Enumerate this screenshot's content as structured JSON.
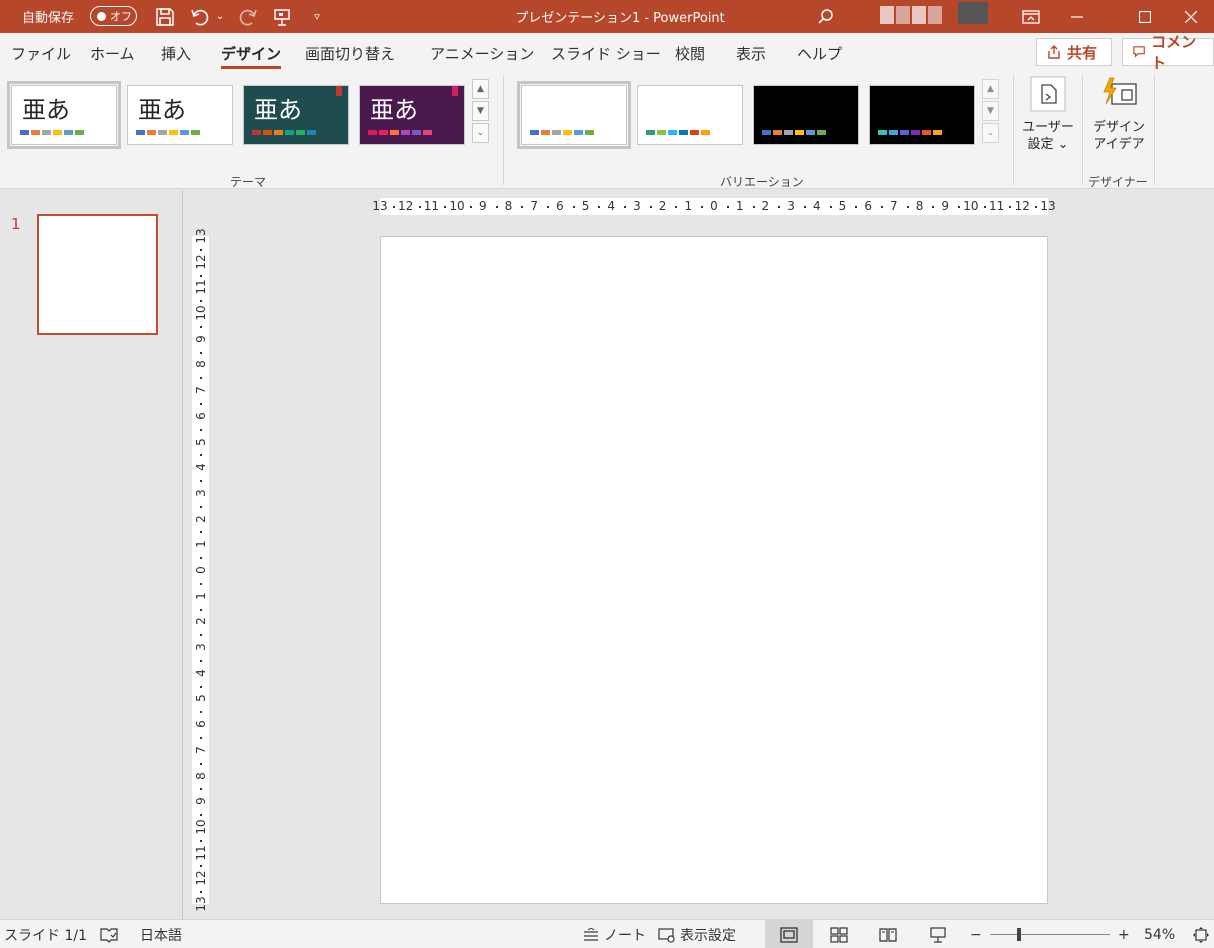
{
  "titlebar": {
    "autosave_label": "自動保存",
    "autosave_state": "オフ",
    "doc_title": "プレゼンテーション1  -  PowerPoint",
    "accent_color": "#b7472a"
  },
  "tabs": [
    {
      "label": "ファイル"
    },
    {
      "label": "ホーム"
    },
    {
      "label": "挿入"
    },
    {
      "label": "デザイン",
      "active": true
    },
    {
      "label": "画面切り替え"
    },
    {
      "label": "アニメーション"
    },
    {
      "label": "スライド ショー"
    },
    {
      "label": "校閲"
    },
    {
      "label": "表示"
    },
    {
      "label": "ヘルプ"
    }
  ],
  "tab_actions": {
    "share_label": "共有",
    "comment_label": "コメント"
  },
  "ribbon": {
    "themes": {
      "group_label": "テーマ",
      "thumb_text": "亜あ",
      "items": [
        {
          "name": "office-theme",
          "bg": "#ffffff",
          "fg": "#262626",
          "colors": [
            "#4472c4",
            "#ed7d31",
            "#a5a5a5",
            "#ffc000",
            "#5b9bd5",
            "#70ad47"
          ]
        },
        {
          "name": "office-theme-2",
          "bg": "#ffffff",
          "fg": "#262626",
          "colors": [
            "#4472c4",
            "#ed7d31",
            "#a5a5a5",
            "#ffc000",
            "#5b9bd5",
            "#70ad47"
          ]
        },
        {
          "name": "teal-theme",
          "bg": "#1f4d4f",
          "fg": "#ffffff",
          "colors": [
            "#c0392b",
            "#d35400",
            "#e67e22",
            "#16a085",
            "#27ae60",
            "#2980b9"
          ]
        },
        {
          "name": "purple-theme",
          "bg": "#4a1a4f",
          "fg": "#ffffff",
          "colors": [
            "#d81b60",
            "#e91e63",
            "#ff7043",
            "#ab47bc",
            "#7e57c2",
            "#ec407a"
          ]
        }
      ]
    },
    "variations": {
      "group_label": "バリエーション",
      "items": [
        {
          "bg": "#ffffff",
          "colors": [
            "#4472c4",
            "#ed7d31",
            "#a5a5a5",
            "#ffc000",
            "#5b9bd5",
            "#70ad47"
          ]
        },
        {
          "bg": "#ffffff",
          "colors": [
            "#2e9e76",
            "#8bc34a",
            "#29b6f6",
            "#0277bd",
            "#d84315",
            "#ffa000"
          ]
        },
        {
          "bg": "#000000",
          "colors": [
            "#4472c4",
            "#ed7d31",
            "#a5a5a5",
            "#ffc000",
            "#5b9bd5",
            "#70ad47"
          ]
        },
        {
          "bg": "#000000",
          "colors": [
            "#2ec4b6",
            "#3fa7d6",
            "#5e60ce",
            "#7b2cbf",
            "#e4572e",
            "#f3a712"
          ]
        }
      ]
    },
    "customize": {
      "label_line1": "ユーザー",
      "label_line2": "設定 ⌄"
    },
    "designer": {
      "label_line1": "デザイン",
      "label_line2": "アイデア",
      "group_label": "デザイナー"
    }
  },
  "slides_panel": {
    "slide_number": "1"
  },
  "ruler": {
    "ticks": [
      "13",
      "12",
      "11",
      "10",
      "9",
      "8",
      "7",
      "6",
      "5",
      "4",
      "3",
      "2",
      "1",
      "0",
      "1",
      "2",
      "3",
      "4",
      "5",
      "6",
      "7",
      "8",
      "9",
      "10",
      "11",
      "12",
      "13"
    ]
  },
  "statusbar": {
    "slide_count": "スライド 1/1",
    "language": "日本語",
    "notes_label": "ノート",
    "display_settings_label": "表示設定",
    "zoom_minus": "−",
    "zoom_plus": "+",
    "zoom_level": "54%"
  }
}
